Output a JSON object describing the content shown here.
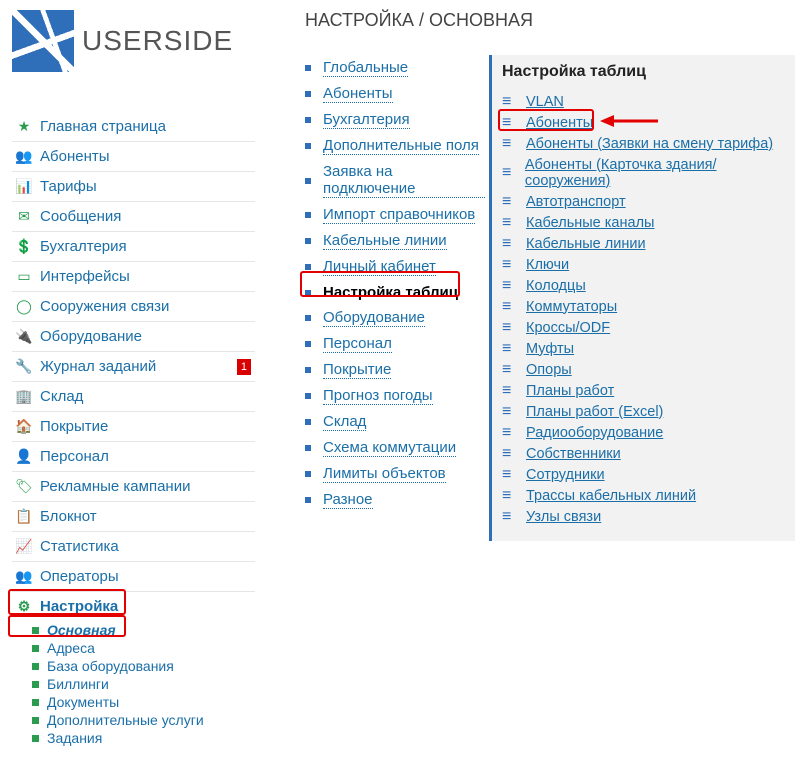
{
  "brand": "USERSIDE",
  "breadcrumb": "НАСТРОЙКА / ОСНОВНАЯ",
  "nav": [
    {
      "icon": "★",
      "label": "Главная страница"
    },
    {
      "icon": "👥",
      "label": "Абоненты"
    },
    {
      "icon": "📊",
      "label": "Тарифы"
    },
    {
      "icon": "✉",
      "label": "Сообщения"
    },
    {
      "icon": "💲",
      "label": "Бухгалтерия"
    },
    {
      "icon": "▭",
      "label": "Интерфейсы"
    },
    {
      "icon": "◯",
      "label": "Сооружения связи"
    },
    {
      "icon": "🔌",
      "label": "Оборудование"
    },
    {
      "icon": "🔧",
      "label": "Журнал заданий",
      "badge": "1"
    },
    {
      "icon": "🏢",
      "label": "Склад"
    },
    {
      "icon": "🏠",
      "label": "Покрытие"
    },
    {
      "icon": "👤",
      "label": "Персонал"
    },
    {
      "icon": "🏷",
      "label": "Рекламные кампании"
    },
    {
      "icon": "📋",
      "label": "Блокнот"
    },
    {
      "icon": "📈",
      "label": "Статистика"
    },
    {
      "icon": "👥",
      "label": "Операторы"
    },
    {
      "icon": "⚙",
      "label": "Настройка"
    }
  ],
  "settings_sub": [
    {
      "label": "Основная",
      "active": true
    },
    {
      "label": "Адреса"
    },
    {
      "label": "База оборудования"
    },
    {
      "label": "Биллинги"
    },
    {
      "label": "Документы"
    },
    {
      "label": "Дополнительные услуги"
    },
    {
      "label": "Задания"
    }
  ],
  "middle_settings": [
    {
      "label": "Глобальные"
    },
    {
      "label": "Абоненты"
    },
    {
      "label": "Бухгалтерия"
    },
    {
      "label": "Дополнительные поля"
    },
    {
      "label": "Заявка на подключение"
    },
    {
      "label": "Импорт справочников"
    },
    {
      "label": "Кабельные линии"
    },
    {
      "label": "Личный кабинет"
    },
    {
      "label": "Настройка таблиц",
      "active": true
    },
    {
      "label": "Оборудование"
    },
    {
      "label": "Персонал"
    },
    {
      "label": "Покрытие"
    },
    {
      "label": "Прогноз погоды"
    },
    {
      "label": "Склад"
    },
    {
      "label": "Схема коммутации"
    },
    {
      "label": "Лимиты объектов"
    },
    {
      "label": "Разное"
    }
  ],
  "tables_title": "Настройка таблиц",
  "tables": [
    "VLAN",
    "Абоненты",
    "Абоненты (Заявки на смену тарифа)",
    "Абоненты (Карточка здания/сооружения)",
    "Автотранспорт",
    "Кабельные каналы",
    "Кабельные линии",
    "Ключи",
    "Колодцы",
    "Коммутаторы",
    "Кроссы/ODF",
    "Муфты",
    "Опоры",
    "Планы работ",
    "Планы работ (Excel)",
    "Радиооборудование",
    "Собственники",
    "Сотрудники",
    "Трассы кабельных линий",
    "Узлы связи"
  ]
}
